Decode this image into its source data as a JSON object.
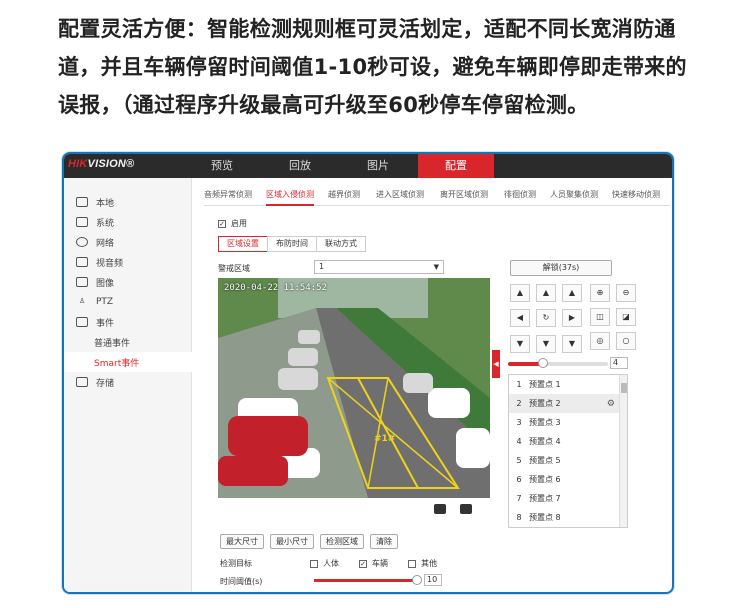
{
  "caption": {
    "line1": "配置灵活方便：智能检测规则框可灵活划定，适配不同长宽消防通",
    "line2": "道，并且车辆停留时间阈值1-10秒可设，避免车辆即停即走带来的",
    "line3": "误报，（通过程序升级最高可升级至60秒停车停留检测。"
  },
  "brand": {
    "logo_red": "HIK",
    "logo_white": "VISION",
    "logo_mark": "®"
  },
  "nav": {
    "tabs": [
      "预览",
      "回放",
      "图片",
      "配置"
    ],
    "active": "配置"
  },
  "sidebar": {
    "items": [
      {
        "label": "本地",
        "icon": "monitor-icon"
      },
      {
        "label": "系统",
        "icon": "system-icon"
      },
      {
        "label": "网络",
        "icon": "globe-icon"
      },
      {
        "label": "视音频",
        "icon": "audio-video-icon"
      },
      {
        "label": "图像",
        "icon": "image-icon"
      },
      {
        "label": "PTZ",
        "icon": "ptz-icon"
      },
      {
        "label": "事件",
        "icon": "calendar-icon"
      },
      {
        "label": "普通事件",
        "icon": ""
      },
      {
        "label": "Smart事件",
        "icon": ""
      },
      {
        "label": "存储",
        "icon": "storage-icon"
      }
    ],
    "active": "Smart事件"
  },
  "subtabs": [
    "音频异常侦测",
    "区域入侵侦测",
    "越界侦测",
    "进入区域侦测",
    "离开区域侦测",
    "徘徊侦测",
    "人员聚集侦测",
    "快速移动侦测"
  ],
  "subtab_active": "区域入侵侦测",
  "enable": {
    "label": "启用",
    "checked": true
  },
  "steps": [
    "区域设置",
    "布防时间",
    "联动方式"
  ],
  "step_active": "区域设置",
  "zone": {
    "label": "警戒区域",
    "value": "1"
  },
  "video": {
    "osd": "2020-04-22 11:54:52",
    "zone_tag": "#1#"
  },
  "ptz": {
    "unlock_label": "解锁(37s)",
    "arrows": [
      "▲",
      "▲",
      "▲",
      "◀",
      "↻",
      "▶",
      "▼",
      "▼",
      "▼"
    ],
    "zoom_icons": [
      "zoom-in-icon",
      "zoom-out-icon",
      "focus-near-icon",
      "focus-far-icon",
      "iris-open-icon",
      "iris-close-icon"
    ],
    "speed_value": "4",
    "speed_level": 0.35
  },
  "presets": [
    {
      "num": "1",
      "name": "预置点 1"
    },
    {
      "num": "2",
      "name": "预置点 2"
    },
    {
      "num": "3",
      "name": "预置点 3"
    },
    {
      "num": "4",
      "name": "预置点 4"
    },
    {
      "num": "5",
      "name": "预置点 5"
    },
    {
      "num": "6",
      "name": "预置点 6"
    },
    {
      "num": "7",
      "name": "预置点 7"
    },
    {
      "num": "8",
      "name": "预置点 8"
    }
  ],
  "buttons": [
    "最大尺寸",
    "最小尺寸",
    "检测区域",
    "清除"
  ],
  "target": {
    "label": "检测目标",
    "options": [
      {
        "label": "人体",
        "checked": false
      },
      {
        "label": "车辆",
        "checked": true
      },
      {
        "label": "其他",
        "checked": false
      }
    ]
  },
  "threshold": {
    "label": "时间阈值(s)",
    "value": "10"
  },
  "colors": {
    "accent": "#d9262d",
    "frame": "#1a73b8",
    "topbar": "#2b2b2b"
  }
}
